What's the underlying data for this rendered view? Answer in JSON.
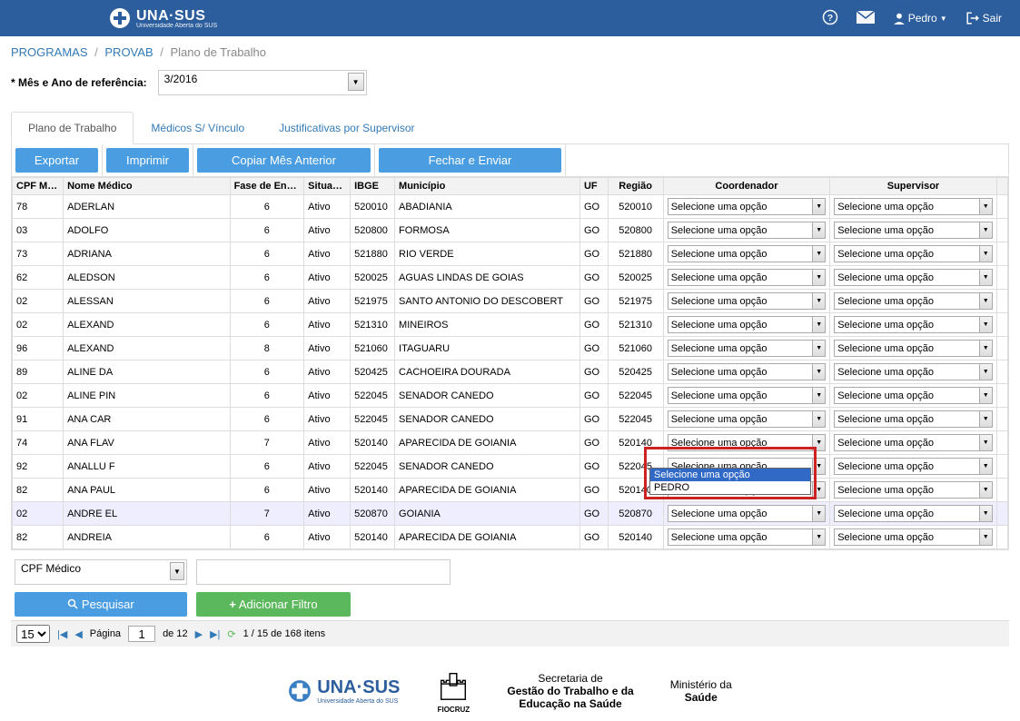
{
  "topbar": {
    "brand": "UNA·SUS",
    "brand_sub": "Universidade Aberta do SUS",
    "user": "Pedro",
    "logout": "Sair"
  },
  "breadcrumb": {
    "a": "PROGRAMAS",
    "b": "PROVAB",
    "c": "Plano de Trabalho"
  },
  "ref": {
    "label": "* Mês e Ano de referência:",
    "value": "3/2016"
  },
  "tabs": {
    "t1": "Plano de Trabalho",
    "t2": "Médicos S/ Vínculo",
    "t3": "Justificativas por Supervisor"
  },
  "toolbar": {
    "exportar": "Exportar",
    "imprimir": "Imprimir",
    "copiar": "Copiar Mês Anterior",
    "fechar": "Fechar e Enviar"
  },
  "cols": {
    "cpf": "CPF Médico",
    "nome": "Nome Médico",
    "fase": "Fase de Entrada",
    "sit": "Situação",
    "ibge": "IBGE",
    "mun": "Município",
    "uf": "UF",
    "reg": "Região",
    "coord": "Coordenador",
    "sup": "Supervisor"
  },
  "default_opt": "Selecione uma opção",
  "rows": [
    {
      "cpf": "78",
      "nome": "ADERLAN",
      "fase": "6",
      "sit": "Ativo",
      "ibge": "520010",
      "mun": "ABADIANIA",
      "uf": "GO",
      "reg": "520010"
    },
    {
      "cpf": "03",
      "nome": "ADOLFO",
      "fase": "6",
      "sit": "Ativo",
      "ibge": "520800",
      "mun": "FORMOSA",
      "uf": "GO",
      "reg": "520800"
    },
    {
      "cpf": "73",
      "nome": "ADRIANA",
      "fase": "6",
      "sit": "Ativo",
      "ibge": "521880",
      "mun": "RIO VERDE",
      "uf": "GO",
      "reg": "521880"
    },
    {
      "cpf": "62",
      "nome": "ALEDSON",
      "fase": "6",
      "sit": "Ativo",
      "ibge": "520025",
      "mun": "AGUAS LINDAS DE GOIAS",
      "uf": "GO",
      "reg": "520025"
    },
    {
      "cpf": "02",
      "nome": "ALESSAN",
      "fase": "6",
      "sit": "Ativo",
      "ibge": "521975",
      "mun": "SANTO ANTONIO DO DESCOBERT",
      "uf": "GO",
      "reg": "521975"
    },
    {
      "cpf": "02",
      "nome": "ALEXAND",
      "fase": "6",
      "sit": "Ativo",
      "ibge": "521310",
      "mun": "MINEIROS",
      "uf": "GO",
      "reg": "521310"
    },
    {
      "cpf": "96",
      "nome": "ALEXAND",
      "fase": "8",
      "sit": "Ativo",
      "ibge": "521060",
      "mun": "ITAGUARU",
      "uf": "GO",
      "reg": "521060"
    },
    {
      "cpf": "89",
      "nome": "ALINE DA",
      "fase": "6",
      "sit": "Ativo",
      "ibge": "520425",
      "mun": "CACHOEIRA DOURADA",
      "uf": "GO",
      "reg": "520425"
    },
    {
      "cpf": "02",
      "nome": "ALINE PIN",
      "fase": "6",
      "sit": "Ativo",
      "ibge": "522045",
      "mun": "SENADOR CANEDO",
      "uf": "GO",
      "reg": "522045"
    },
    {
      "cpf": "91",
      "nome": "ANA CAR",
      "fase": "6",
      "sit": "Ativo",
      "ibge": "522045",
      "mun": "SENADOR CANEDO",
      "uf": "GO",
      "reg": "522045"
    },
    {
      "cpf": "74",
      "nome": "ANA FLAV",
      "fase": "7",
      "sit": "Ativo",
      "ibge": "520140",
      "mun": "APARECIDA DE GOIANIA",
      "uf": "GO",
      "reg": "520140"
    },
    {
      "cpf": "92",
      "nome": "ANALLU F",
      "fase": "6",
      "sit": "Ativo",
      "ibge": "522045",
      "mun": "SENADOR CANEDO",
      "uf": "GO",
      "reg": "522045"
    },
    {
      "cpf": "82",
      "nome": "ANA PAUL",
      "fase": "6",
      "sit": "Ativo",
      "ibge": "520140",
      "mun": "APARECIDA DE GOIANIA",
      "uf": "GO",
      "reg": "520140"
    },
    {
      "cpf": "02",
      "nome": "ANDRE EL",
      "fase": "7",
      "sit": "Ativo",
      "ibge": "520870",
      "mun": "GOIANIA",
      "uf": "GO",
      "reg": "520870"
    },
    {
      "cpf": "82",
      "nome": "ANDREIA",
      "fase": "6",
      "sit": "Ativo",
      "ibge": "520140",
      "mun": "APARECIDA DE GOIANIA",
      "uf": "GO",
      "reg": "520140"
    }
  ],
  "dropdown": {
    "opt1": "Selecione uma opção",
    "opt2": "PEDRO"
  },
  "filter": {
    "field": "CPF Médico",
    "search": "Pesquisar",
    "add": "Adicionar Filtro"
  },
  "pager": {
    "size": "15",
    "page_lbl": "Página",
    "page": "1",
    "of": "de 12",
    "items": "1 / 15 de 168 itens"
  },
  "footer": {
    "una": "UNA·SUS",
    "una_sub": "Universidade Aberta do SUS",
    "fiocruz": "FIOCRUZ",
    "sec1": "Secretaria de",
    "sec2": "Gestão do Trabalho e da",
    "sec3": "Educação na Saúde",
    "min1": "Ministério da",
    "min2": "Saúde"
  }
}
